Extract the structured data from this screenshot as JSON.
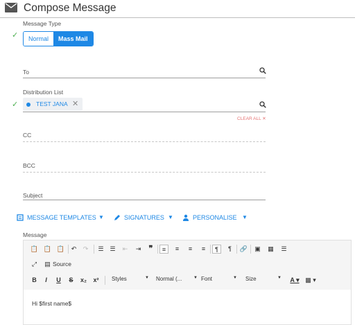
{
  "header": {
    "title": "Compose Message",
    "icon": "envelope-icon"
  },
  "message_type": {
    "label": "Message Type",
    "options": [
      "Normal",
      "Mass Mail"
    ],
    "selected": "Mass Mail"
  },
  "to": {
    "label": "To"
  },
  "distribution_list": {
    "label": "Distribution List",
    "chips": [
      "TEST JANA"
    ],
    "clear_all": "CLEAR ALL"
  },
  "cc": {
    "label": "CC"
  },
  "bcc": {
    "label": "BCC"
  },
  "subject": {
    "label": "Subject"
  },
  "toolbar": {
    "templates": "MESSAGE TEMPLATES",
    "signatures": "SIGNATURES",
    "personalise": "PERSONALISE"
  },
  "message": {
    "label": "Message",
    "source_label": "Source",
    "styles": "Styles",
    "format": "Normal (...",
    "font": "Font",
    "size": "Size",
    "superscript": "x²",
    "subscript": "x₂",
    "body": "Hi $first name$"
  },
  "colors": {
    "accent": "#1e88e5",
    "check": "#4caf50",
    "clear": "#e57373"
  }
}
